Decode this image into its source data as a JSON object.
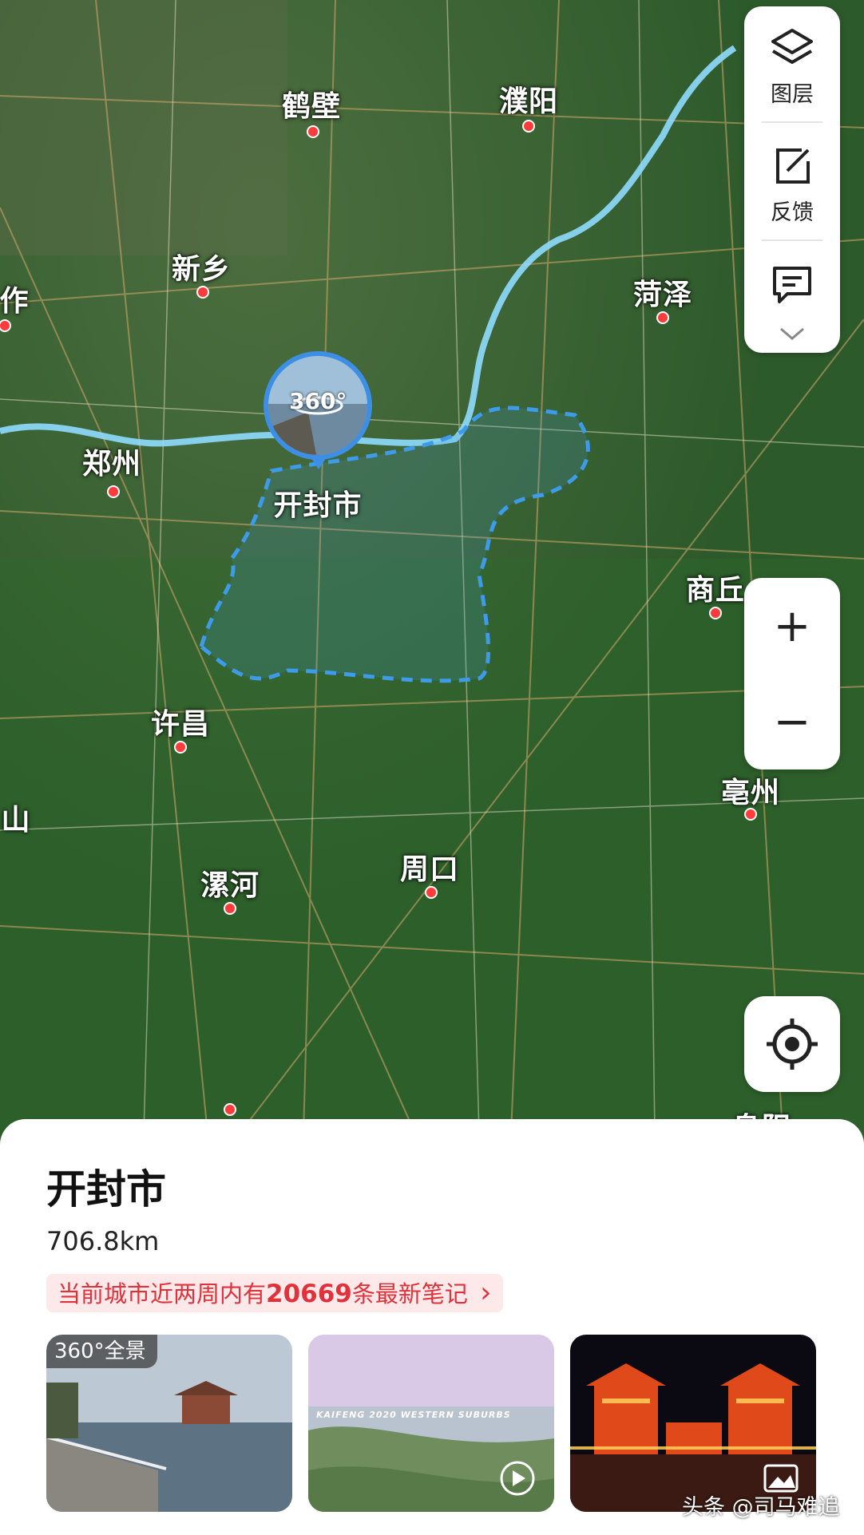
{
  "map": {
    "cities": [
      {
        "name": "鹤壁"
      },
      {
        "name": "濮阳"
      },
      {
        "name": "新乡"
      },
      {
        "name": "作"
      },
      {
        "name": "菏泽"
      },
      {
        "name": "郑州"
      },
      {
        "name": "开封市"
      },
      {
        "name": "商丘"
      },
      {
        "name": "许昌"
      },
      {
        "name": "亳州"
      },
      {
        "name": "山"
      },
      {
        "name": "周口"
      },
      {
        "name": "漯河"
      },
      {
        "name": "阜阳"
      }
    ],
    "pano_label": "360°",
    "river_color": "#7fd6ff",
    "boundary_color": "#3d9bea"
  },
  "side_panel": {
    "layers_label": "图层",
    "feedback_label": "反馈"
  },
  "zoom": {
    "in_label": "+",
    "out_label": "−"
  },
  "sheet": {
    "title": "开封市",
    "distance": "706.8km",
    "banner_prefix": "当前城市近两周内有",
    "banner_count": "20669",
    "banner_suffix": "条最新笔记",
    "banner_arrow": "›",
    "thumbnails": [
      {
        "badge": "360°全景",
        "icon": "none"
      },
      {
        "caption": "KAIFENG 2020 WESTERN SUBURBS",
        "icon": "play-icon"
      },
      {
        "icon": "image-icon"
      }
    ]
  },
  "watermark": "头条 @司马难追"
}
